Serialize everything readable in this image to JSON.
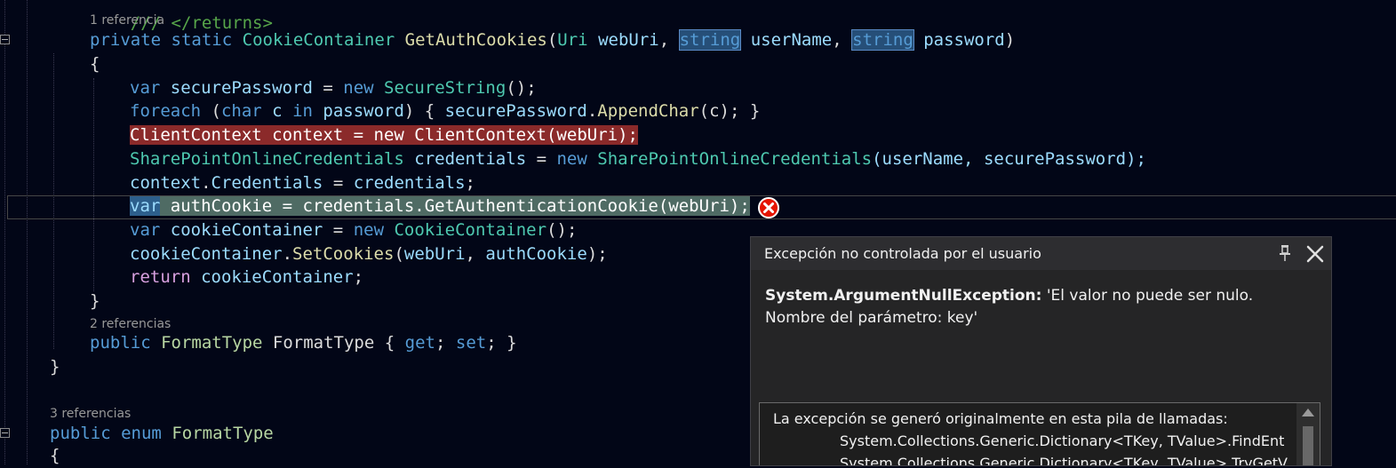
{
  "editor": {
    "codelens": {
      "refs_1": "1 referencia",
      "refs_2": "2 referencias",
      "refs_3": "3 referencias"
    },
    "lines": {
      "top_comment": "/// </returns>",
      "sig": {
        "private": "private",
        "static": "static",
        "ret_type": "CookieContainer",
        "method": "GetAuthCookies",
        "open": "(",
        "uri": "Uri",
        "p1": "webUri",
        "comma1": ",",
        "string1": "string",
        "p2": "userName",
        "comma2": ",",
        "string2": "string",
        "p3": "password",
        "close": ")"
      },
      "brace_open": "{",
      "l1": {
        "var": "var",
        "name": "securePassword",
        "eq": " = ",
        "new": "new",
        "type": "SecureString",
        "rest": "();"
      },
      "l2": {
        "foreach": "foreach",
        "open": " (",
        "char": "char",
        "c": " c ",
        "in": "in",
        "password": " password",
        "rest1": ") { ",
        "sp": "securePassword",
        "dot": ".",
        "method": "AppendChar",
        "rest2": "(c); }"
      },
      "l3": {
        "text": "ClientContext context = new ClientContext(webUri);"
      },
      "l4": {
        "type": "SharePointOnlineCredentials",
        "name": " credentials",
        "eq": " = ",
        "new": "new",
        "type2": "SharePointOnlineCredentials",
        "rest": "(userName, securePassword);"
      },
      "l5": {
        "ctx": "context",
        "dot": ".",
        "prop": "Credentials",
        "eq": " = ",
        "cred": "credentials",
        "semi": ";"
      },
      "l6": {
        "var": "var",
        "rest": " authCookie = credentials.GetAuthenticationCookie(webUri);"
      },
      "l7": {
        "var": "var",
        "name": " cookieContainer",
        "eq": " = ",
        "new": "new",
        "type": "CookieContainer",
        "rest": "();"
      },
      "l8": {
        "cc": "cookieContainer",
        "dot": ".",
        "method": "SetCookies",
        "open": "(",
        "a1": "webUri",
        "comma": ", ",
        "a2": "authCookie",
        "rest": ");"
      },
      "l9": {
        "ret": "return",
        "name": " cookieContainer",
        "semi": ";"
      },
      "brace_close": "}",
      "prop": {
        "public": "public",
        "type": "FormatType",
        "name": " FormatType",
        "open": " { ",
        "get": "get",
        "mid": "; ",
        "set": "set",
        "end": "; }"
      },
      "class_close": "}",
      "enum_line": {
        "public": "public",
        "enum": "enum",
        "name": "FormatType"
      },
      "enum_open": "{"
    }
  },
  "exception_popup": {
    "title": "Excepción no controlada por el usuario",
    "pin_icon": "pin-icon",
    "close_icon": "close-icon",
    "exception_type": "System.ArgumentNullException:",
    "message_line1": " 'El valor no puede ser nulo.",
    "message_line2": "Nombre del parámetro: key'",
    "stack_header": "La excepción se generó originalmente en esta pila de llamadas:",
    "stack_line1": "System.Collections.Generic.Dictionary<TKey, TValue>.FindEnt",
    "stack_line2": "System.Collections.Generic.Dictionary<TKey, TValue>.TryGetV"
  },
  "colors": {
    "background": "#020617",
    "keyword": "#569cd6",
    "type": "#4ec9b0",
    "method": "#dcdcaa",
    "error_highlight": "#8b2a2a",
    "current_statement": "#4f6b64",
    "error_icon": "#e51400"
  }
}
